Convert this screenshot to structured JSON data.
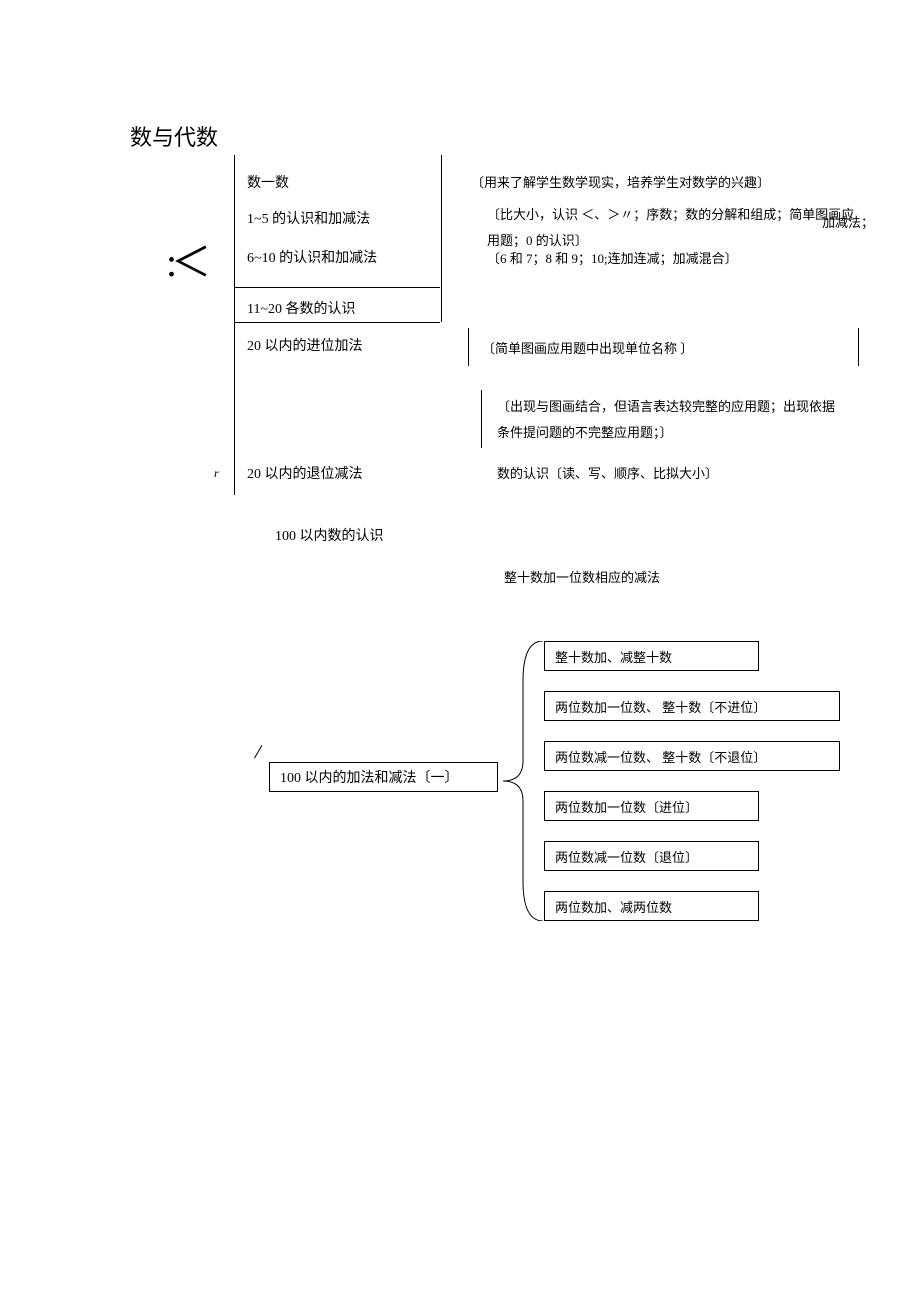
{
  "title": "数与代数",
  "left": {
    "i1": "数一数",
    "i2": "1~5 的认识和加减法",
    "i3": "6~10 的认识和加减法",
    "i4": "11~20 各数的认识",
    "i5": "20 以内的进位加法",
    "i6": "20 以内的退位减法",
    "i7": "100 以内数的认识"
  },
  "symbol": ":＜",
  "marker": "r",
  "right": {
    "d1": "〔用来了解学生数学现实，培养学生对数学的兴趣〕",
    "d2": "〔比大小，认识 ＜、＞〃；序数；数的分解和组成；简单图画应用题；0 的认识〕",
    "d2b": "加减法；",
    "d3": "〔6 和 7；8 和 9；10;连加连减；加减混合〕",
    "d5": "〔简单图画应用题中出现单位名称 〕",
    "d6": "〔出现与图画结合，但语言表达较完整的应用题；出现依据条件提问题的不完整应用题；〕",
    "d7": "数的认识〔读、写、顺序、比拟大小〕",
    "d8": "整十数加一位数相应的减法"
  },
  "box100": "100 以内的加法和减法〔一〕",
  "sub": {
    "s1": "整十数加、减整十数",
    "s2": "两位数加一位数、 整十数〔不进位〕",
    "s3": "两位数减一位数、 整十数〔不退位〕",
    "s4": "两位数加一位数〔进位〕",
    "s5": "两位数减一位数〔退位〕",
    "s6": "两位数加、减两位数"
  }
}
